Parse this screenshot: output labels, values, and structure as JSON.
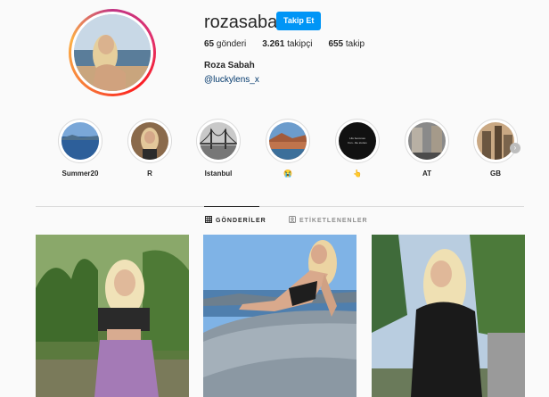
{
  "profile": {
    "username": "rozasabah",
    "follow_label": "Takip Et",
    "posts_count": "65",
    "posts_label": "gönderi",
    "followers_count": "3.261",
    "followers_label": "takipçi",
    "following_count": "655",
    "following_label": "takip",
    "full_name": "Roza Sabah",
    "bio_handle": "@luckylens_x"
  },
  "highlights": [
    {
      "label": "Summer20",
      "icon": "sea-photo"
    },
    {
      "label": "R",
      "icon": "girl-photo"
    },
    {
      "label": "Istanbul",
      "icon": "bridge-photo"
    },
    {
      "label": "😭",
      "icon": "lake-photo"
    },
    {
      "label": "👆",
      "icon": "text-card"
    },
    {
      "label": "AT",
      "icon": "street-photo"
    },
    {
      "label": "GB",
      "icon": "city-photo"
    }
  ],
  "highlight_card_text": [
    "Life becomes",
    "Fun...lite stories"
  ],
  "tabs": {
    "posts": "GÖNDERİLER",
    "tagged": "ETİKETLENENLER"
  },
  "colors": {
    "accent": "#0095f6",
    "text": "#262626",
    "link": "#00376b",
    "divider": "#dbdbdb"
  }
}
